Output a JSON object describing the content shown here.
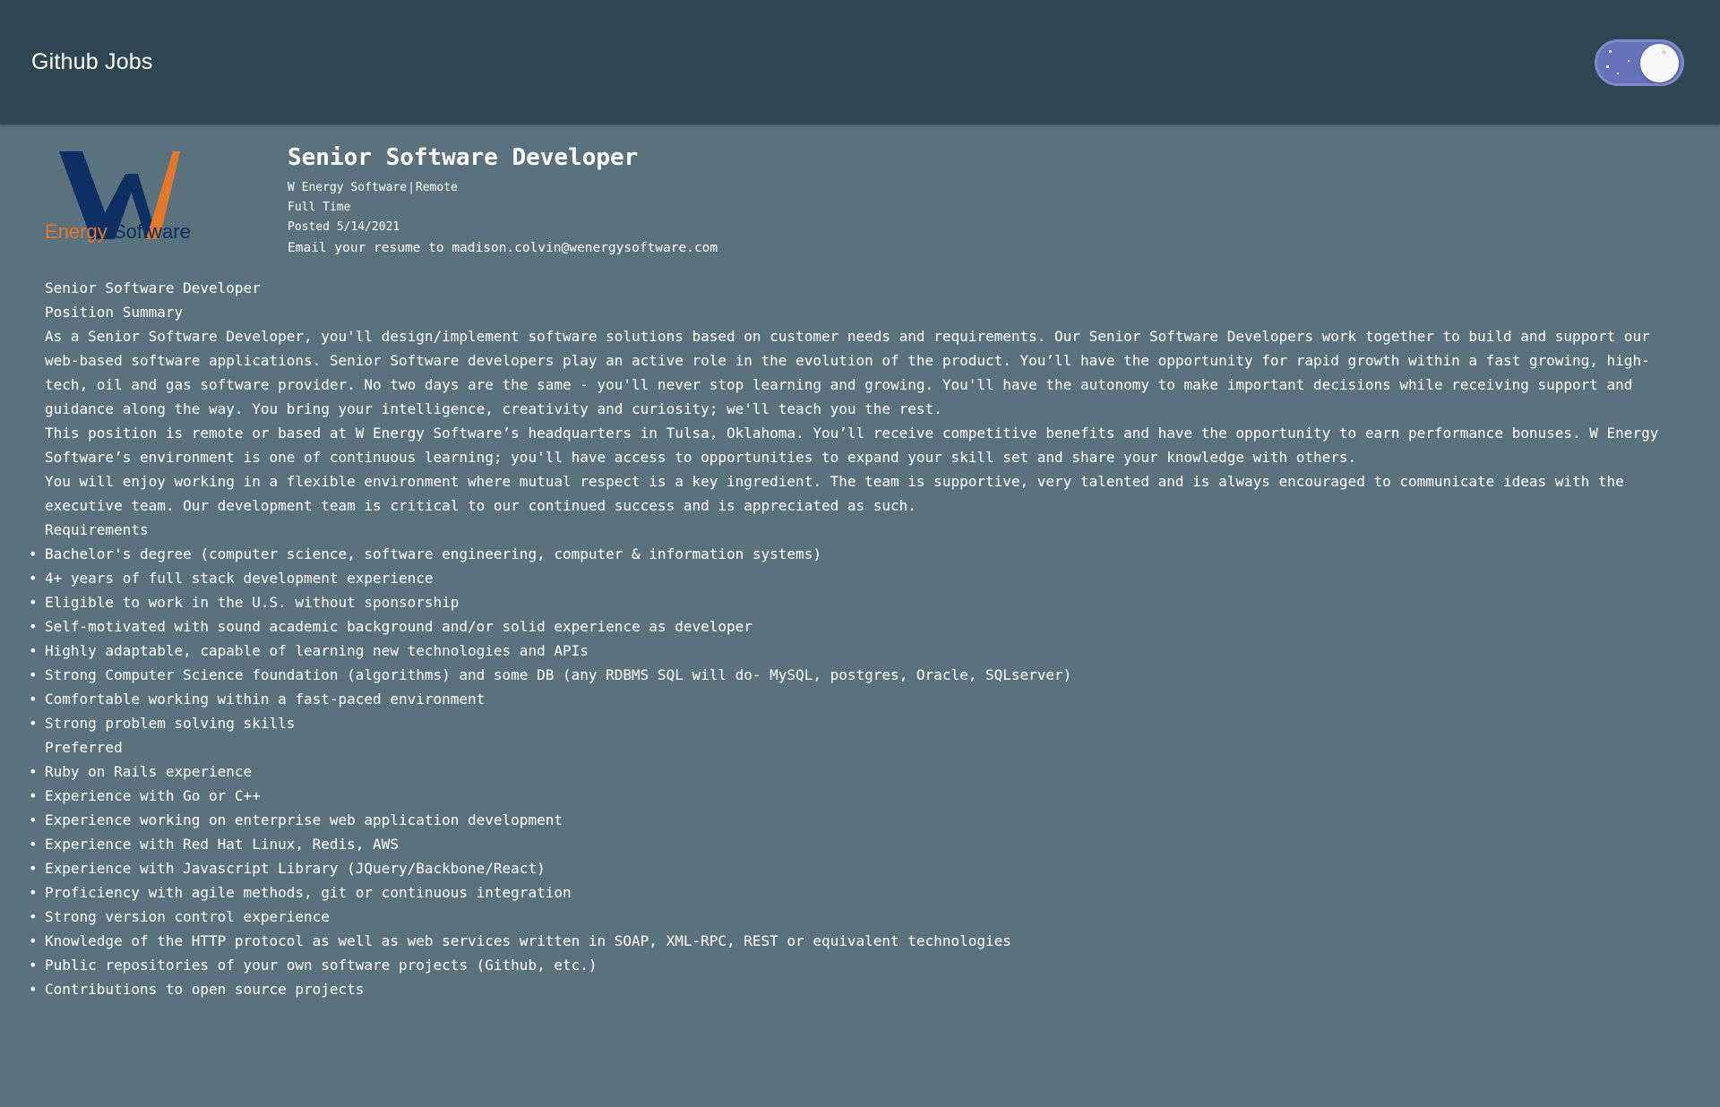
{
  "app": {
    "title": "Github Jobs"
  },
  "job": {
    "title": "Senior Software Developer",
    "company": "W Energy Software",
    "location": "Remote",
    "type": "Full Time",
    "posted": "Posted 5/14/2021",
    "how_to_apply": "Email your resume to madison.colvin@wenergysoftware.com",
    "logo": {
      "mark": "W",
      "text": "Energy Software",
      "colors": {
        "navy": "#0d2f63",
        "orange": "#e1782b"
      }
    }
  },
  "description": {
    "title_line": "Senior Software Developer",
    "summary_heading": "Position Summary",
    "paragraphs": [
      "As a Senior Software Developer, you'll design/implement software solutions based on customer needs and requirements. Our Senior Software Developers work together to build and support our web-based software applications. Senior Software developers play an active role in the evolution of the product. You’ll have the opportunity for rapid growth within a fast growing, high-tech, oil and gas software provider. No two days are the same - you'll never stop learning and growing. You'll have the autonomy to make important decisions while receiving support and guidance along the way. You bring your intelligence, creativity and curiosity; we'll teach you the rest.",
      "This position is remote or based at W Energy Software’s headquarters in Tulsa, Oklahoma. You’ll receive competitive benefits and have the opportunity to earn performance bonuses. W Energy Software’s environment is one of continuous learning; you'll have access to opportunities to expand your skill set and share your knowledge with others.",
      "You will enjoy working in a flexible environment where mutual respect is a key ingredient. The team is supportive, very talented and is always encouraged to communicate ideas with the executive team. Our development team is critical to our continued success and is appreciated as such."
    ],
    "requirements_heading": "Requirements",
    "requirements": [
      "Bachelor's degree (computer science, software engineering, computer & information systems)",
      "4+ years of full stack development experience",
      "Eligible to work in the U.S. without sponsorship",
      "Self-motivated with sound academic background and/or solid experience as developer",
      "Highly adaptable, capable of learning new technologies and APIs",
      "Strong Computer Science foundation (algorithms) and some DB (any RDBMS SQL will do- MySQL, postgres, Oracle, SQLserver)",
      "Comfortable working within a fast-paced environment",
      "Strong problem solving skills"
    ],
    "preferred_heading": "Preferred",
    "preferred": [
      "Ruby on Rails experience",
      "Experience with Go or C++",
      "Experience working on enterprise web application development",
      "Experience with Red Hat Linux, Redis, AWS",
      "Experience with Javascript Library (JQuery/Backbone/React)",
      "Proficiency with agile methods, git or continuous integration",
      "Strong version control experience",
      "Knowledge of the HTTP protocol as well as web services written in SOAP, XML-RPC, REST or equivalent technologies",
      "Public repositories of your own software projects (Github, etc.)",
      "Contributions to open source projects"
    ]
  },
  "theme": {
    "toggle_icon": "moon-icon",
    "mode": "dark",
    "colors": {
      "header_bg": "#2e4552",
      "page_bg": "#5a717e",
      "toggle_bg": "#6673b9"
    }
  }
}
